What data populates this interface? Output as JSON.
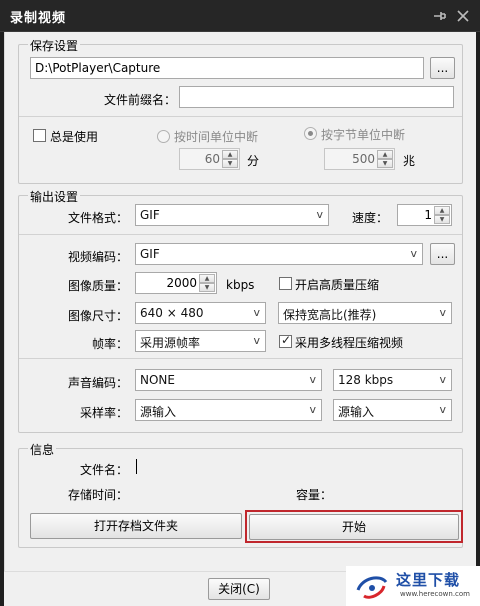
{
  "window": {
    "title": "录制视频"
  },
  "save": {
    "group_title": "保存设置",
    "path": "D:\\PotPlayer\\Capture",
    "browse_label": "...",
    "prefix_label": "文件前缀名：",
    "prefix_value": "",
    "always_use_label": "总是使用",
    "by_time_label": "按时间单位中断",
    "by_bytes_label": "按字节单位中断",
    "time_value": "60",
    "time_unit": "分",
    "bytes_value": "500",
    "bytes_unit": "兆"
  },
  "output": {
    "group_title": "输出设置",
    "format_label": "文件格式：",
    "format_value": "GIF",
    "speed_label": "速度：",
    "speed_value": "1",
    "video_codec_label": "视频编码：",
    "video_codec_value": "GIF",
    "codec_browse_label": "...",
    "quality_label": "图像质量：",
    "quality_value": "2000",
    "quality_unit": "kbps",
    "hq_label": "开启高质量压缩",
    "size_label": "图像尺寸：",
    "size_value": "640 × 480",
    "aspect_value": "保持宽高比(推荐)",
    "fps_label": "帧率：",
    "fps_value": "采用源帧率",
    "multithread_label": "采用多线程压缩视频",
    "audio_codec_label": "声音编码：",
    "audio_codec_value": "NONE",
    "bitrate_value": "128 kbps",
    "sample_label": "采样率：",
    "sample_value": "源输入",
    "channel_value": "源输入"
  },
  "info": {
    "group_title": "信息",
    "filename_label": "文件名：",
    "storage_time_label": "存储时间：",
    "capacity_label": "容量：",
    "open_folder_label": "打开存档文件夹",
    "start_label": "开始"
  },
  "footer": {
    "close_label": "关闭(C)"
  },
  "watermark": {
    "text": "这里下载",
    "url": "www.herecown.com"
  },
  "colors": {
    "titlebar": "#262626",
    "client": "#f0f0f0",
    "highlight": "#c0272d"
  }
}
